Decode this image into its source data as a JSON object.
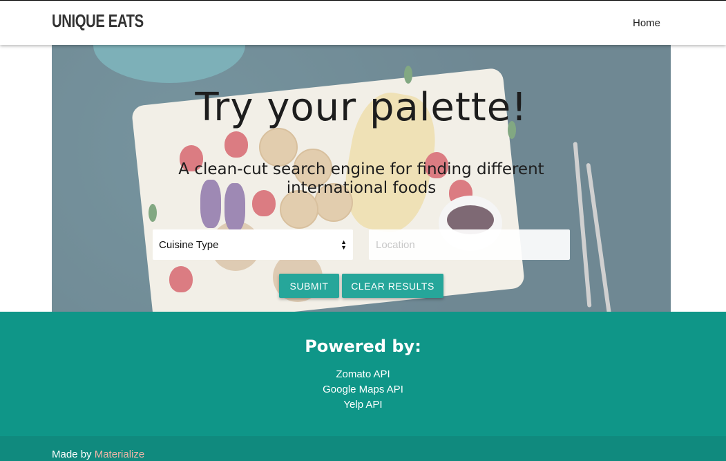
{
  "navbar": {
    "brand": "UNIQUE EATS",
    "home_link": "Home"
  },
  "hero": {
    "title": "Try your palette!",
    "subtitle": "A clean-cut search engine for finding different international foods",
    "cuisine_select": {
      "selected": "Cuisine Type"
    },
    "location_input": {
      "placeholder": "Location",
      "value": ""
    },
    "submit_label": "SUBMIT",
    "clear_label": "CLEAR RESULTS"
  },
  "footer": {
    "heading": "Powered by:",
    "links": [
      "Zomato API",
      "Google Maps API",
      "Yelp API"
    ],
    "made_by_prefix": "Made by",
    "made_by_link": "Materialize"
  },
  "colors": {
    "accent": "#26a69a",
    "footer_bg": "#0f9688",
    "footer_bottom_bg": "#108a7e",
    "link_pink": "#f2b5a8"
  }
}
